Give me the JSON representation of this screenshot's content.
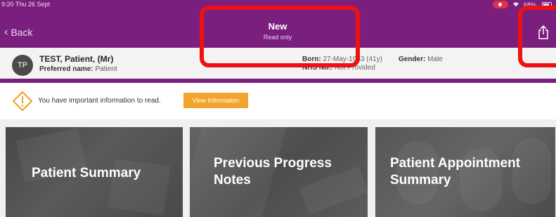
{
  "status_bar": {
    "time": "9:20  Thu 26 Sept",
    "battery": "68%"
  },
  "nav": {
    "back_label": "Back",
    "title": "New",
    "subtitle": "Read only"
  },
  "patient": {
    "initials": "TP",
    "name": "TEST, Patient, (Mr)",
    "preferred_label": "Preferred name:",
    "preferred_value": "Patient",
    "born_label": "Born:",
    "born_value": "27-May-1983 (41y)",
    "gender_label": "Gender:",
    "gender_value": "Male",
    "nhs_label": "NHS No.:",
    "nhs_value": "Not Provided"
  },
  "alert": {
    "message": "You have important information to read.",
    "button_label": "View Information"
  },
  "tiles": [
    {
      "title": "Patient Summary"
    },
    {
      "title": "Previous Progress Notes"
    },
    {
      "title": "Patient Appointment Summary"
    }
  ],
  "colors": {
    "brand_purple": "#7a1f7e",
    "button_orange": "#f3a42c",
    "warning_icon": "#f0a020",
    "annotation_red": "#ee1111"
  },
  "icons": {
    "back": "chevron-left-icon",
    "share": "share-icon",
    "warning": "warning-diamond-icon"
  }
}
